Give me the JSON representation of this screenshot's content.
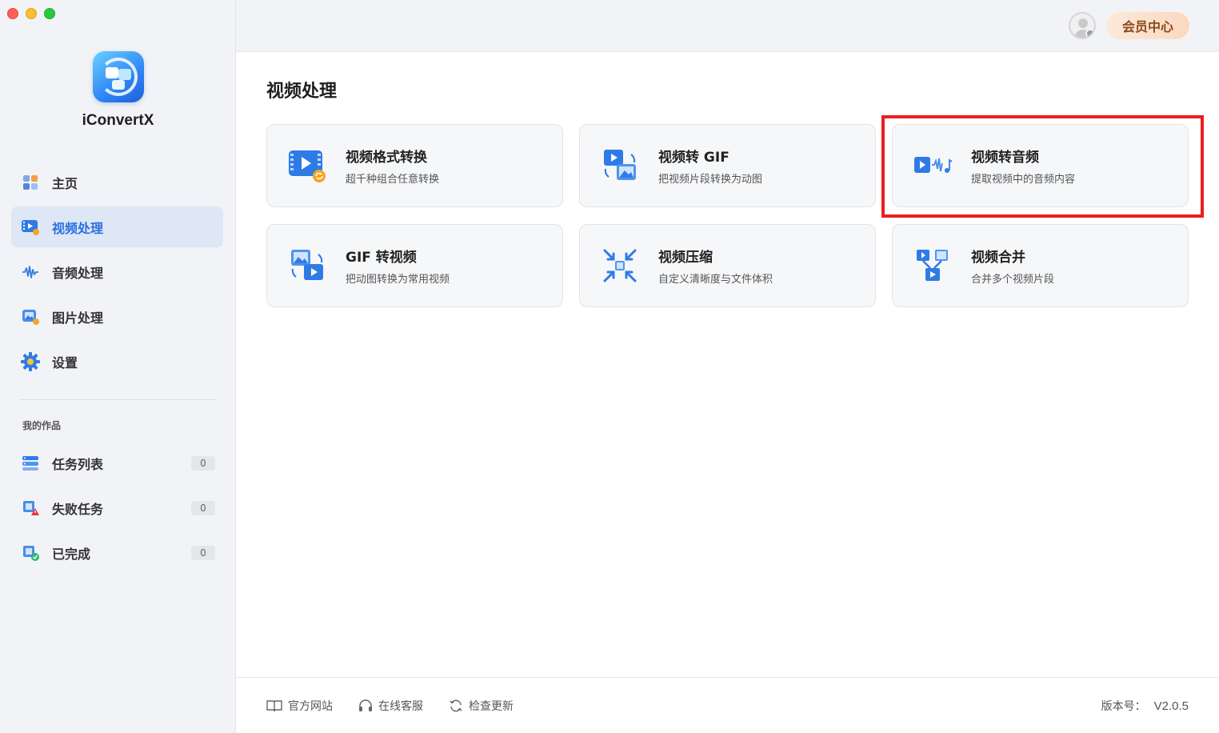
{
  "app": {
    "name": "iConvertX"
  },
  "sidebar": {
    "nav": [
      {
        "label": "主页",
        "icon": "home-grid-icon"
      },
      {
        "label": "视频处理",
        "icon": "video-icon",
        "active": true
      },
      {
        "label": "音频处理",
        "icon": "audio-wave-icon"
      },
      {
        "label": "图片处理",
        "icon": "image-icon"
      },
      {
        "label": "设置",
        "icon": "gear-icon"
      }
    ],
    "section_label": "我的作品",
    "works": [
      {
        "label": "任务列表",
        "count": "0",
        "icon": "task-list-icon"
      },
      {
        "label": "失败任务",
        "count": "0",
        "icon": "failed-task-icon"
      },
      {
        "label": "已完成",
        "count": "0",
        "icon": "completed-icon"
      }
    ]
  },
  "topbar": {
    "vip_label": "会员中心"
  },
  "main": {
    "title": "视频处理",
    "cards": [
      {
        "title": "视频格式转换",
        "subtitle": "超千种组合任意转换",
        "icon": "video-convert-icon"
      },
      {
        "title": "视频转 GIF",
        "subtitle": "把视频片段转换为动图",
        "icon": "video-to-gif-icon"
      },
      {
        "title": "视频转音频",
        "subtitle": "提取视频中的音频内容",
        "icon": "video-to-audio-icon",
        "highlighted": true
      },
      {
        "title": "GIF 转视频",
        "subtitle": "把动图转换为常用视频",
        "icon": "gif-to-video-icon"
      },
      {
        "title": "视频压缩",
        "subtitle": "自定义清晰度与文件体积",
        "icon": "compress-icon"
      },
      {
        "title": "视频合并",
        "subtitle": "合并多个视频片段",
        "icon": "merge-icon"
      }
    ]
  },
  "footer": {
    "links": [
      {
        "label": "官方网站",
        "icon": "book-icon"
      },
      {
        "label": "在线客服",
        "icon": "headset-icon"
      },
      {
        "label": "检查更新",
        "icon": "refresh-icon"
      }
    ],
    "version_label": "版本号：",
    "version_value": "V2.0.5"
  },
  "colors": {
    "accent": "#2b6fe0",
    "highlight_border": "#e8201f",
    "vip_text": "#8a4a1c"
  }
}
